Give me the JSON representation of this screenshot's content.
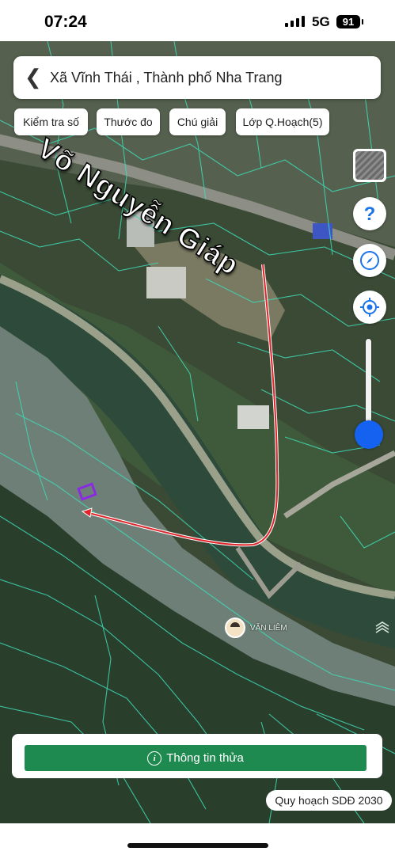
{
  "status_bar": {
    "time": "07:24",
    "network": "5G",
    "battery": "91"
  },
  "search": {
    "location": "Xã Vĩnh Thái , Thành phố Nha Trang"
  },
  "toolbar": {
    "chips": [
      "Kiểm tra số",
      "Thước đo",
      "Chú giải",
      "Lớp Q.Hoạch(5)"
    ]
  },
  "map": {
    "road_label": "Võ Nguyễn Giáp",
    "poi_label": "VĂN LIÊM",
    "route_color": "#e0242a",
    "parcel_line_color": "#3fd9b5",
    "selected_parcel_color": "#8a2be2"
  },
  "controls": {
    "icons": [
      "layers-icon",
      "help-icon",
      "compass-icon",
      "locate-icon"
    ],
    "zoom_level": 0.85
  },
  "bottom": {
    "info_button": "Thông tin thửa",
    "plan_badge": "Quy hoạch SDĐ 2030"
  }
}
